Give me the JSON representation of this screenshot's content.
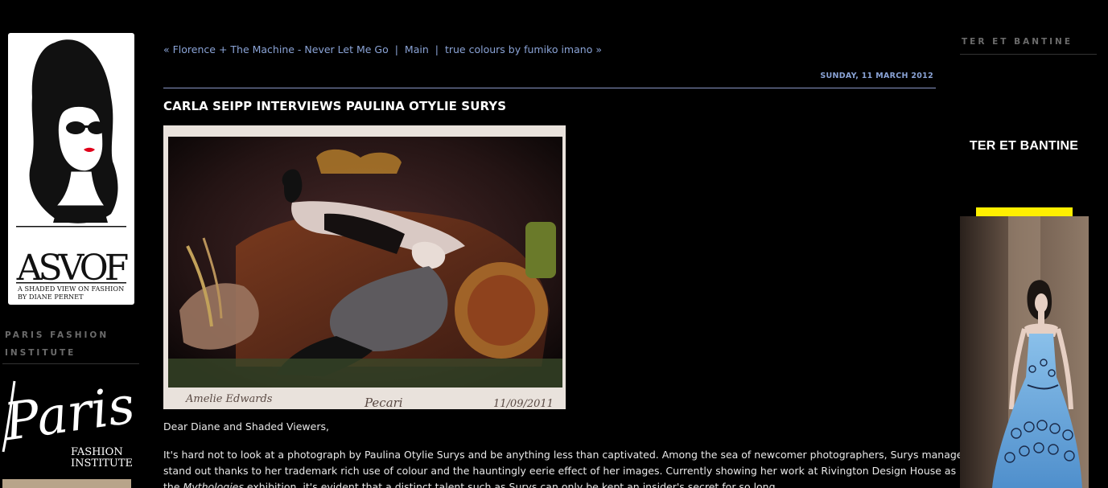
{
  "left_sidebar": {
    "logo": {
      "wordmark": "ASVOF",
      "tagline_line1": "A SHADED VIEW ON FASHION",
      "tagline_line2": "BY DIANE PERNET"
    },
    "heading": "PARIS FASHION INSTITUTE",
    "pfi_logo": {
      "script_text": "Paris",
      "line1": "FASHION",
      "line2": "INSTITUTE"
    }
  },
  "post": {
    "nav": {
      "prev_label": "« Florence + The Machine - Never Let Me Go",
      "main_label": "Main",
      "next_label": "true colours by fumiko imano »",
      "separator": "|"
    },
    "date": "SUNDAY, 11 MARCH 2012",
    "title": "CARLA SEIPP INTERVIEWS PAULINA OTYLIE SURYS",
    "photo_inscription_left": "Amelie Edwards",
    "photo_inscription_mid": "Pecari",
    "photo_inscription_right": "11/09/2011",
    "greeting": "Dear Diane and Shaded Viewers,",
    "body": {
      "line1": "It's hard not to look at a photograph by Paulina Otylie Surys and be anything less than captivated. Among the sea of newcomer photographers, Surys manages to",
      "line2": "stand out thanks to her trademark rich use of colour and the hauntingly eerie effect of her images. Currently showing her work at Rivington Design House as part of",
      "line3_pre": "the ",
      "line3_em": "Mythologies",
      "line3_post": " exhibition, it's evident that a distinct talent such as Surys can only be kept an insider's secret for so long..."
    }
  },
  "right_sidebar": {
    "heading": "TER ET BANTINE",
    "brand_title": "TER ET BANTINE"
  },
  "colors": {
    "background": "#000000",
    "link": "#8aa3d6",
    "sidebar_heading": "#6b6b6b",
    "accent_yellow": "#ffef00",
    "dress_blue": "#6fa8dc"
  }
}
